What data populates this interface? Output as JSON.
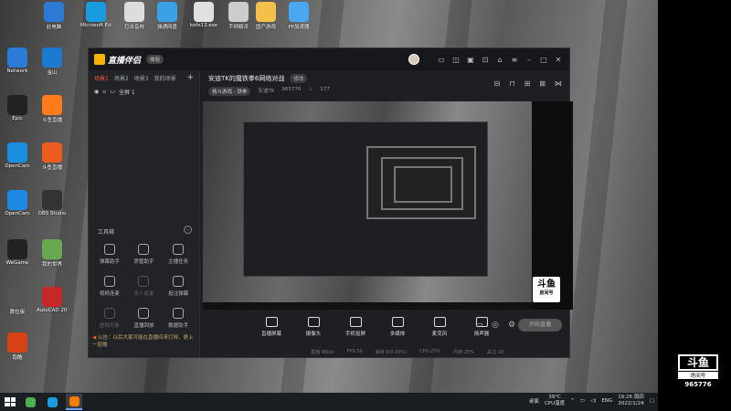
{
  "desktop_icons": [
    {
      "label": "此电脑",
      "icon": "computer-icon",
      "color": "#2b7bd6"
    },
    {
      "label": "Microsoft Edge",
      "icon": "edge-icon",
      "color": "#1a9be0"
    },
    {
      "label": "打击音效",
      "icon": "file-icon",
      "color": "#dddddd"
    },
    {
      "label": "城通网盘",
      "icon": "cloud-icon",
      "color": "#3aa0e8"
    },
    {
      "label": "kofe13.exe",
      "icon": "game-icon",
      "color": "#e0e0e0"
    },
    {
      "label": "手柄精灵",
      "icon": "gamepad-icon",
      "color": "#cccccc"
    },
    {
      "label": "国产游戏",
      "icon": "folder-icon",
      "color": "#f3c14a"
    },
    {
      "label": "PP加速器",
      "icon": "app-icon",
      "color": "#4aa8f0"
    },
    {
      "label": "Network",
      "icon": "network-icon",
      "color": "#2b7bd6"
    },
    {
      "label": "金山",
      "icon": "app-icon",
      "color": "#1c7ad0"
    },
    {
      "label": "Epic",
      "icon": "epic-icon",
      "color": "#222222"
    },
    {
      "label": "斗鱼直播",
      "icon": "douyu-icon",
      "color": "#ff7a1a"
    },
    {
      "label": "OpenCam",
      "icon": "camera-icon",
      "color": "#1a8fe0"
    },
    {
      "label": "斗鱼直播",
      "icon": "app-icon",
      "color": "#ee5b1f"
    },
    {
      "label": "OpenCam",
      "icon": "camera-icon",
      "color": "#1e88e5"
    },
    {
      "label": "OBS Studio",
      "icon": "obs-icon",
      "color": "#333333"
    },
    {
      "label": "WeGame",
      "icon": "wegame-icon",
      "color": "#222222"
    },
    {
      "label": "我的世界",
      "icon": "minecraft-icon",
      "color": "#6aa84f"
    },
    {
      "label": "数位板",
      "icon": "tablet-icon",
      "color": "#555555"
    },
    {
      "label": "AutoCAD 2007",
      "icon": "cad-icon",
      "color": "#c62828"
    },
    {
      "label": "跑酷",
      "icon": "app-icon",
      "color": "#d84315"
    }
  ],
  "app": {
    "brand": "直播伴侣",
    "version_pill": "体验",
    "title_icons": [
      "user-icon",
      "message-icon",
      "clip-icon",
      "box-icon",
      "cast-icon",
      "shirt-icon",
      "menu-icon",
      "minimize-icon",
      "maximize-icon",
      "close-icon"
    ],
    "scene_tabs": [
      "场景1",
      "场景2",
      "场景3",
      "我的场景"
    ],
    "scene_item": "全屏 1",
    "toolbox_title": "工具箱",
    "tools": [
      {
        "label": "弹幕助手",
        "dim": false
      },
      {
        "label": "房管助手",
        "dim": false
      },
      {
        "label": "主播任务",
        "dim": false
      },
      {
        "label": "视频连麦",
        "dim": false
      },
      {
        "label": "多人连麦",
        "dim": true
      },
      {
        "label": "投注弹幕",
        "dim": false
      },
      {
        "label": "虚拟形象",
        "dim": true
      },
      {
        "label": "直播回放",
        "dim": false
      },
      {
        "label": "数据助手",
        "dim": false
      }
    ],
    "notice": "公告：以后大家可能在直播间来打排，更上一层楼",
    "room": {
      "title": "安迪TK的魔铁拳6网络对战",
      "edit_label": "修改",
      "category": "格斗游戏 - 铁拳",
      "anchor": "安迪TK",
      "room_id": "965776",
      "heat": "177"
    },
    "main_icons": [
      "panel-icon",
      "lock-icon",
      "box-icon",
      "grid-icon",
      "share-icon"
    ],
    "controls": [
      {
        "label": "直播屏幕",
        "icon": "screen-icon"
      },
      {
        "label": "摄像头",
        "icon": "camera-icon"
      },
      {
        "label": "手机投屏",
        "icon": "phone-icon"
      },
      {
        "label": "多媒体",
        "icon": "media-icon"
      },
      {
        "label": "麦克风",
        "icon": "mic-icon"
      },
      {
        "label": "扬声器",
        "icon": "speaker-icon"
      }
    ],
    "start_label": "开始直播",
    "status": [
      "直播 0Kb/s",
      "FPS:30",
      "丢帧 0(0.00%)",
      "CPU:25%",
      "内存:25%",
      "关注:18"
    ]
  },
  "taskbar": {
    "apps": [
      {
        "icon": "chrome-icon",
        "color": "#4caf50",
        "active": false
      },
      {
        "icon": "edge-icon",
        "color": "#1a9be0",
        "active": false
      },
      {
        "icon": "livestream-icon",
        "color": "#f57c00",
        "active": true
      }
    ],
    "tray_label": "桌面",
    "temp": "39°C",
    "temp_sub": "CPU温度",
    "lang": "ENG",
    "time": "19:26 周四",
    "date": "2022/1/24"
  },
  "watermark": {
    "brand": "斗鱼",
    "sub": "房间号",
    "room_id": "965776"
  }
}
